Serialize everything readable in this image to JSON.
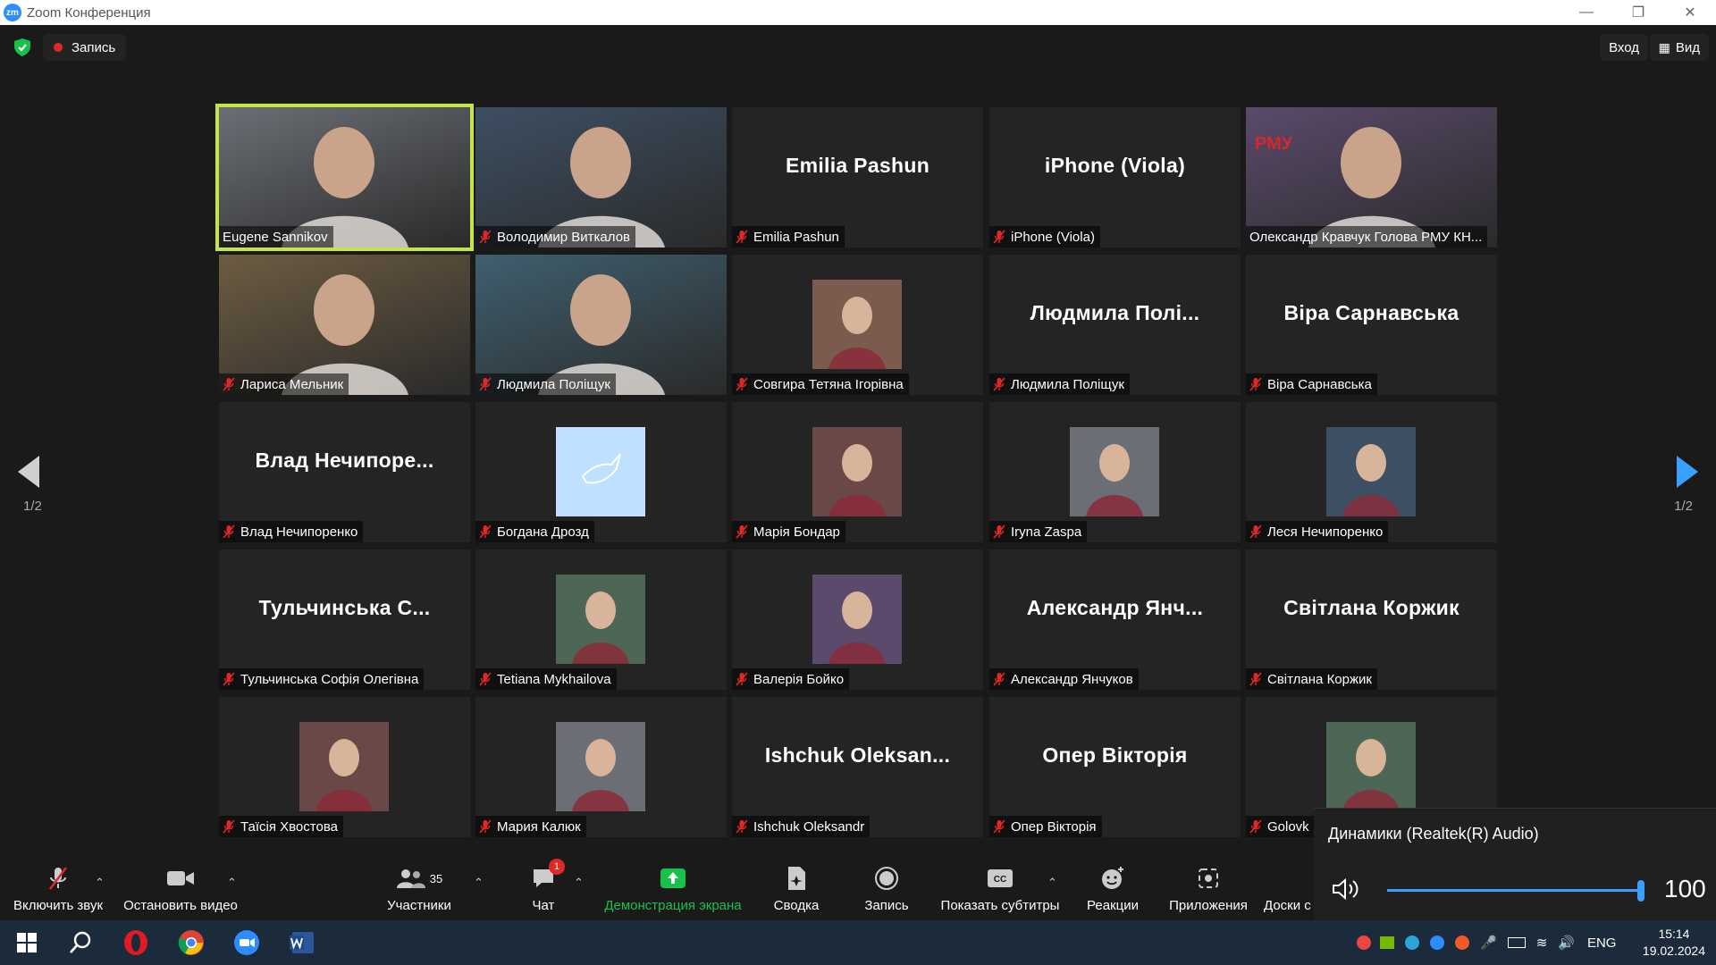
{
  "window": {
    "title": "Zoom Конференция",
    "app_logo": "zm"
  },
  "topbar": {
    "record_label": "Запись",
    "signin_label": "Вход",
    "view_label": "Вид"
  },
  "pagination": {
    "left": "1/2",
    "right": "1/2"
  },
  "tiles": [
    {
      "label": "Eugene Sannikov",
      "bigname": "",
      "muted": false,
      "media": "video",
      "active": true
    },
    {
      "label": "Володимир Виткалов",
      "bigname": "",
      "muted": true,
      "media": "video"
    },
    {
      "label": "Emilia Pashun",
      "bigname": "Emilia Pashun",
      "muted": true,
      "media": "none"
    },
    {
      "label": "iPhone (Viola)",
      "bigname": "iPhone (Viola)",
      "muted": true,
      "media": "none"
    },
    {
      "label": "Олександр Кравчук Голова РМУ КН...",
      "bigname": "",
      "muted": false,
      "media": "video",
      "logo_text": "РМУ"
    },
    {
      "label": "Лариса Мельник",
      "bigname": "",
      "muted": true,
      "media": "video"
    },
    {
      "label": "Людмила Поліщук",
      "bigname": "",
      "muted": true,
      "media": "video"
    },
    {
      "label": "Совгира Тетяна Ігорівна",
      "bigname": "",
      "muted": true,
      "media": "avatar"
    },
    {
      "label": "Людмила Поліщук",
      "bigname": "Людмила Полі...",
      "muted": true,
      "media": "none"
    },
    {
      "label": "Віра Сарнавська",
      "bigname": "Віра Сарнавська",
      "muted": true,
      "media": "none"
    },
    {
      "label": "Влад Нечипоренко",
      "bigname": "Влад  Нечипоре...",
      "muted": true,
      "media": "none"
    },
    {
      "label": "Богдана Дрозд",
      "bigname": "",
      "muted": true,
      "media": "avatar-dove"
    },
    {
      "label": "Марія Бондар",
      "bigname": "",
      "muted": true,
      "media": "avatar"
    },
    {
      "label": "Iryna Zaspa",
      "bigname": "",
      "muted": true,
      "media": "avatar"
    },
    {
      "label": "Леся Нечипоренко",
      "bigname": "",
      "muted": true,
      "media": "avatar"
    },
    {
      "label": "Тульчинська Софія Олегівна",
      "bigname": "Тульчинська  С...",
      "muted": true,
      "media": "none"
    },
    {
      "label": "Tetiana Mykhailova",
      "bigname": "",
      "muted": true,
      "media": "avatar"
    },
    {
      "label": "Валерія Бойко",
      "bigname": "",
      "muted": true,
      "media": "avatar"
    },
    {
      "label": "Александр Янчуков",
      "bigname": "Александр  Янч...",
      "muted": true,
      "media": "none"
    },
    {
      "label": "Світлана Коржик",
      "bigname": "Світлана Коржик",
      "muted": true,
      "media": "none"
    },
    {
      "label": "Таїсія Хвостова",
      "bigname": "",
      "muted": true,
      "media": "avatar"
    },
    {
      "label": "Мария Калюк",
      "bigname": "",
      "muted": true,
      "media": "avatar"
    },
    {
      "label": "Ishchuk Oleksandr",
      "bigname": "Ishchuk  Oleksan...",
      "muted": true,
      "media": "none"
    },
    {
      "label": "Опер Вікторія",
      "bigname": "Опер Вікторія",
      "muted": true,
      "media": "none"
    },
    {
      "label": "Golovk",
      "bigname": "",
      "muted": true,
      "media": "avatar"
    }
  ],
  "toolbar": {
    "unmute": "Включить звук",
    "stop_video": "Остановить видео",
    "participants": "Участники",
    "participants_count": "35",
    "chat": "Чат",
    "chat_badge": "1",
    "share": "Демонстрация экрана",
    "summary": "Сводка",
    "record": "Запись",
    "captions": "Показать субтитры",
    "reactions": "Реакции",
    "apps": "Приложения",
    "boards": "Доски с",
    "captions_icon_text": "CC"
  },
  "volume_popup": {
    "device": "Динамики (Realtek(R) Audio)",
    "level": 100
  },
  "taskbar": {
    "lang": "ENG",
    "time": "15:14",
    "date": "19.02.2024"
  },
  "colors": {
    "accent": "#2d8cff",
    "share_green": "#17c24b",
    "active_border": "#c7e34a",
    "mute_red": "#e02828"
  }
}
